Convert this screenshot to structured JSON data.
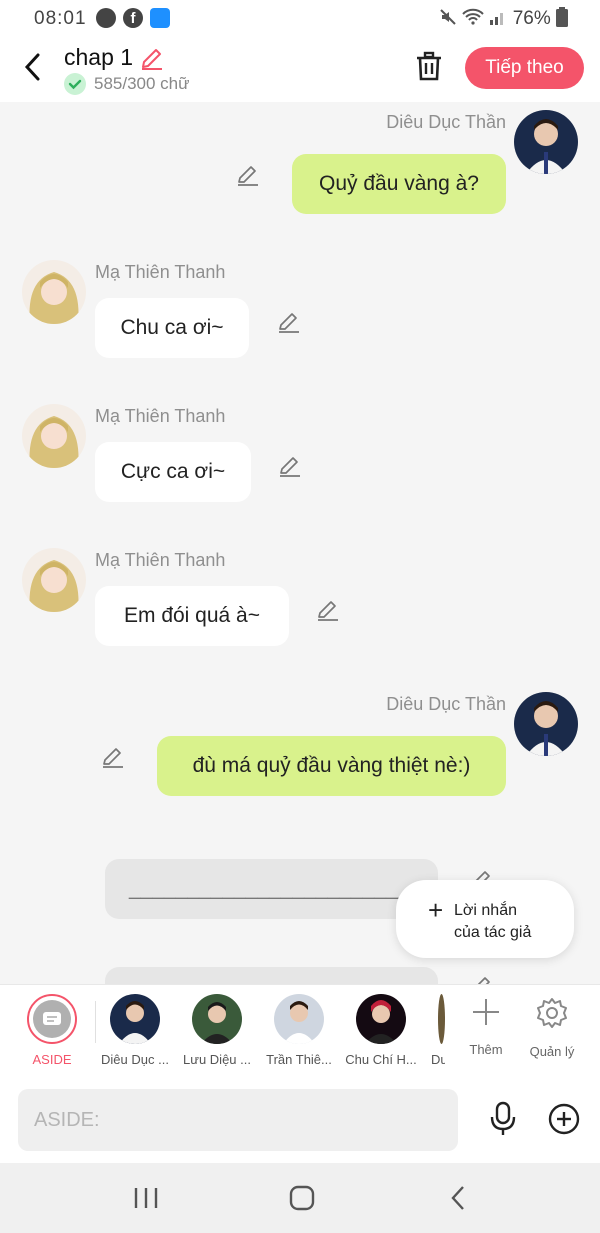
{
  "status_bar": {
    "time": "08:01",
    "battery": "76%"
  },
  "header": {
    "title": "chap 1",
    "word_count": "585/300 chữ",
    "next_label": "Tiếp theo"
  },
  "messages": [
    {
      "speaker": "Diêu Dục Thần",
      "text": "Quỷ đầu vàng à?",
      "side": "right"
    },
    {
      "speaker": "Mạ Thiên Thanh",
      "text": "Chu ca ơi~",
      "side": "left"
    },
    {
      "speaker": "Mạ Thiên Thanh",
      "text": "Cực ca ơi~",
      "side": "left"
    },
    {
      "speaker": "Mạ Thiên Thanh",
      "text": "Em đói quá à~",
      "side": "left"
    },
    {
      "speaker": "Diêu Dục Thần",
      "text": "đù má quỷ đầu vàng thiệt nè:)",
      "side": "right"
    },
    {
      "speaker": "",
      "text": "________________________",
      "side": "aside"
    }
  ],
  "author_note": {
    "label": "Lời nhắn\ncủa tác giả"
  },
  "characters": {
    "aside_label": "ASIDE",
    "items": [
      {
        "label": "Diêu Dục ..."
      },
      {
        "label": "Lưu Diệu ..."
      },
      {
        "label": "Trần Thiê..."
      },
      {
        "label": "Chu Chí H..."
      },
      {
        "label": "Du"
      }
    ],
    "add_label": "Thêm",
    "manage_label": "Quản lý"
  },
  "composer": {
    "placeholder": "ASIDE:"
  },
  "colors": {
    "accent": "#f4546a",
    "green_bubble": "#d9f28c",
    "background": "#f5f5f5"
  },
  "icons": {
    "back": "chevron-left-icon",
    "edit": "pencil-icon",
    "check": "check-icon",
    "trash": "trash-icon",
    "mic": "microphone-icon",
    "add": "plus-circle-icon",
    "settings": "gear-icon"
  }
}
